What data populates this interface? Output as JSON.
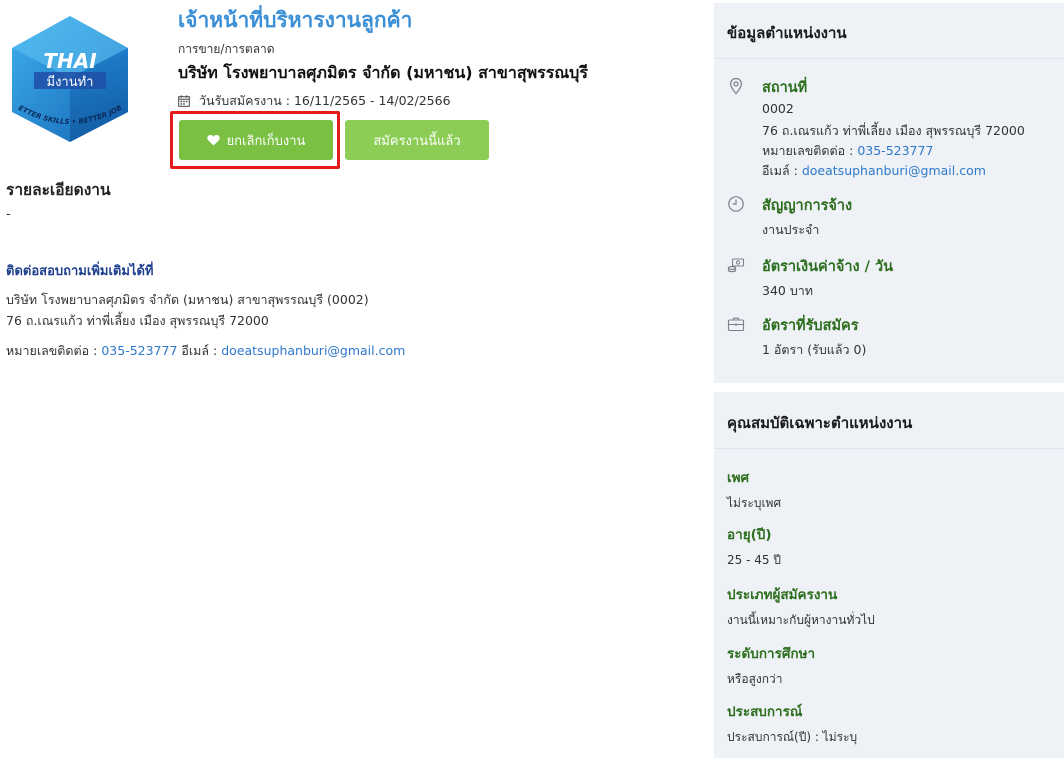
{
  "logo": {
    "line1": "THAI",
    "line2": "มีงานทำ",
    "ring_text": "BETTER SKILLS • BETTER JOBS"
  },
  "job": {
    "title": "เจ้าหน้าที่บริหารงานลูกค้า",
    "category": "การขาย/การตลาด",
    "company": "บริษัท โรงพยาบาลศุภมิตร จำกัด (มหาชน) สาขาสุพรรณบุรี",
    "apply_date": "วันรับสมัครงาน : 16/11/2565 - 14/02/2566"
  },
  "buttons": {
    "unsave_label": "ยกเลิกเก็บงาน",
    "applied_label": "สมัครงานนี้แล้ว"
  },
  "details": {
    "title": "รายละเอียดงาน",
    "text": "-"
  },
  "contact": {
    "title": "ติดต่อสอบถามเพิ่มเติมได้ที่",
    "line1": "บริษัท โรงพยาบาลศุภมิตร จำกัด (มหาชน) สาขาสุพรรณบุรี (0002)",
    "line2": "76 ถ.เณรแก้ว ท่าพี่เลี้ยง เมือง สุพรรณบุรี 72000",
    "phone_label": "หมายเลขติดต่อ : ",
    "phone": "035-523777",
    "email_label": " อีเมล์ : ",
    "email": "doeatsuphanburi@gmail.com"
  },
  "info_panel": {
    "title": "ข้อมูลตำแหน่งงาน",
    "location": {
      "label": "สถานที่",
      "code": "0002",
      "address": "76 ถ.เณรแก้ว ท่าพี่เลี้ยง เมือง สุพรรณบุรี 72000",
      "phone_label": "หมายเลขติดต่อ : ",
      "phone": "035-523777",
      "email_label": "อีเมล์ : ",
      "email": "doeatsuphanburi@gmail.com"
    },
    "contract": {
      "label": "สัญญาการจ้าง",
      "value": "งานประจำ"
    },
    "wage": {
      "label": "อัตราเงินค่าจ้าง / วัน",
      "value": "340 บาท"
    },
    "positions": {
      "label": "อัตราที่รับสมัคร",
      "value": "1 อัตรา (รับแล้ว 0)"
    }
  },
  "qual_panel": {
    "title": "คุณสมบัติเฉพาะตำแหน่งงาน",
    "items": [
      {
        "label": "เพศ",
        "value": "ไม่ระบุเพศ"
      },
      {
        "label": "อายุ(ปี)",
        "value": "25 - 45 ปี"
      },
      {
        "label": "ประเภทผู้สมัครงาน",
        "value": "งานนี้เหมาะกับผู้หางานทั่วไป"
      },
      {
        "label": "ระดับการศึกษา",
        "value": "หรือสูงกว่า"
      },
      {
        "label": "ประสบการณ์",
        "value": "ประสบการณ์(ปี) : ไม่ระบุ"
      }
    ]
  },
  "colors": {
    "title_blue": "#3a8fd6",
    "green_button": "#7cc242",
    "highlight_red": "#e41b1b",
    "label_green": "#2d6e1e",
    "link_blue": "#2f79c9",
    "panel_bg": "#eef2f6"
  },
  "icons": {
    "calendar": "calendar-icon",
    "heart": "heart-icon",
    "location": "location-pin-icon",
    "contract": "clock-icon",
    "wage": "money-icon",
    "positions": "briefcase-icon"
  }
}
